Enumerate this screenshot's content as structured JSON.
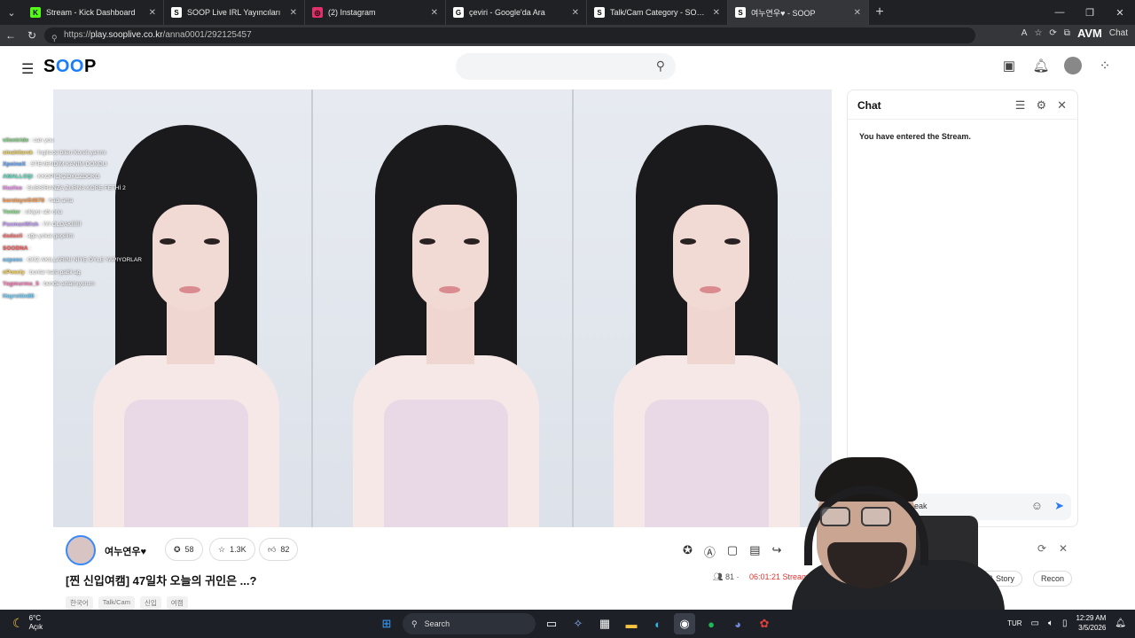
{
  "browser": {
    "tabs": [
      {
        "title": "Stream - Kick Dashboard",
        "fav": "K",
        "color": "#53fc18",
        "active": false
      },
      {
        "title": "SOOP Live IRL Yayıncıları",
        "fav": "S",
        "color": "#ffffff",
        "active": false
      },
      {
        "title": "(2) Instagram",
        "fav": "◎",
        "color": "#e1306c",
        "active": false
      },
      {
        "title": "çeviri - Google'da Ara",
        "fav": "G",
        "color": "#ffffff",
        "active": false
      },
      {
        "title": "Talk/Cam Category - SOOP",
        "fav": "S",
        "color": "#ffffff",
        "active": false
      },
      {
        "title": "여누연우♥ - SOOP",
        "fav": "S",
        "color": "#ffffff",
        "active": true
      }
    ],
    "url_prefix": "https://",
    "url_host": "play.sooplive.co.kr",
    "url_path": "/anna0001/292125457",
    "brand": "AVM",
    "chat_btn": "Chat"
  },
  "header": {
    "logo_s": "S",
    "logo_oo": "OO",
    "logo_p": "P",
    "icons": [
      "video-camera-icon",
      "bell-icon",
      "profile-icon",
      "apps-grid-icon"
    ]
  },
  "overlay_chat": [
    {
      "name": "",
      "msg": "",
      "color": "#9aa"
    },
    {
      "name": "vilontride",
      "msg": "can you",
      "color": "#7fd37f"
    },
    {
      "name": "sinahilarsk",
      "msg": "İngilizce bilen Koreli yarımı",
      "color": "#f0d35a"
    },
    {
      "name": "XpoineX",
      "msg": "STEVENDİM KANIM DONDU",
      "color": "#5aa0ff"
    },
    {
      "name": "AMALLOŞI",
      "msg": "KKOPICKZOKCZDOKG",
      "color": "#56e0c0"
    },
    {
      "name": "Huzfoo",
      "msg": "SUBSİRANZA ZURNA KORE FETHİ 2",
      "color": "#f08cf0"
    },
    {
      "name": "baratayoi54678",
      "msg": "hadi ama",
      "color": "#ff9b4a"
    },
    {
      "name": "Yenter",
      "msg": "sikiyor abi onu",
      "color": "#7fe07f"
    },
    {
      "name": "PasmanWish",
      "msg": "İYİ OLDAKİİİİİİ",
      "color": "#c49bff"
    },
    {
      "name": "dadasli",
      "msg": "ağa yokal geçelim",
      "color": "#ff6b6b"
    },
    {
      "name": "SOODNA",
      "msg": "",
      "color": "#ff5555"
    },
    {
      "name": "ozpoex",
      "msg": "GÜZ AKILLARINI NİYE ÖYLE YAPIYORLAR",
      "color": "#66c3ff"
    },
    {
      "name": "nPoecly",
      "msg": "bunlar kare pabil ag",
      "color": "#ffd24a"
    },
    {
      "name": "Yagmurmu_5",
      "msg": "bende anlamıyorum",
      "color": "#ff7ab8"
    },
    {
      "name": "Hayrettin88",
      "msg": "",
      "color": "#6ad0ff"
    }
  ],
  "chat": {
    "title": "Chat",
    "entered": "You have entered the Stream.",
    "input_value": "peak",
    "icons": [
      "user-list-icon",
      "gear-icon",
      "close-icon"
    ]
  },
  "stream": {
    "streamer_name": "여누연우♥",
    "stats": [
      {
        "icon": "★",
        "value": "58"
      },
      {
        "icon": "☆",
        "value": "1.3K"
      },
      {
        "icon": "👍",
        "value": "82"
      }
    ],
    "title": "[찐 신입여캠] 47일차 오늘의 귀인은 ...?",
    "viewers": "81",
    "uptime": "06:01:21 Streaming",
    "tags": [
      "한국어",
      "Talk/Cam",
      "신입",
      "여캠"
    ],
    "related_tabs": [
      "h & Story",
      "Recon"
    ]
  },
  "taskbar": {
    "temp": "6°C",
    "condition": "Açık",
    "search": "Search",
    "lang": "TUR",
    "time": "12:29 AM",
    "date": "3/5/2026"
  }
}
